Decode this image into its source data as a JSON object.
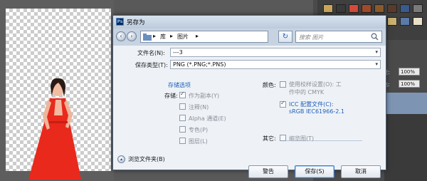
{
  "dialog": {
    "title": "另存为",
    "app_icon_text": "Ps"
  },
  "navbar": {
    "breadcrumb": [
      "库",
      "图片"
    ],
    "search_placeholder": "搜索 图片"
  },
  "form": {
    "filename_label": "文件名(N):",
    "filename_value": "---3",
    "filetype_label": "保存类型(T):",
    "filetype_value": "PNG (*.PNG;*.PNS)"
  },
  "save_options": {
    "section_title": "存储选项",
    "store_label": "存储:",
    "as_copy": "作为副本(Y)",
    "notes": "注释(N)",
    "alpha": "Alpha 通道(E)",
    "spot_color": "专色(P)",
    "layers": "图层(L)"
  },
  "color_options": {
    "color_label": "颜色:",
    "proof_setup_line1": "使用校样设置(O): 工",
    "proof_setup_line2": "作中的 CMYK",
    "icc_line1": "ICC 配置文件(C):",
    "icc_line2": "sRGB IEC61966-2.1",
    "other_label": "其它:",
    "thumbnail": "缩览图(T)"
  },
  "buttons": {
    "warning": "警告",
    "save": "保存(S)",
    "cancel": "取消",
    "browse": "浏览文件夹(B)"
  },
  "right_panel": {
    "opacity_label": "明度:",
    "opacity_value": "100%",
    "fill_label": "填充:",
    "fill_value": "100%"
  },
  "colors": {
    "accent_link": "#1f5fb4",
    "dress_red": "#e8291c",
    "dialog_frame": "#c7d3e0"
  }
}
